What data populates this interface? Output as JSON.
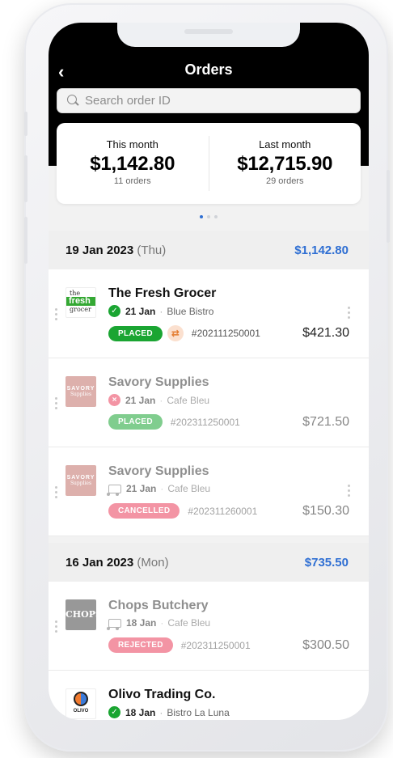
{
  "header": {
    "title": "Orders",
    "back_icon": "chevron-left-icon"
  },
  "search": {
    "placeholder": "Search order ID"
  },
  "summary": {
    "this_month": {
      "label": "This month",
      "amount": "$1,142.80",
      "count": "11 orders"
    },
    "last_month": {
      "label": "Last month",
      "amount": "$12,715.90",
      "count": "29 orders"
    }
  },
  "pager": {
    "pages": 3,
    "active": 0
  },
  "groups": [
    {
      "date": "19 Jan 2023",
      "weekday": "(Thu)",
      "total": "$1,142.80"
    },
    {
      "date": "16 Jan 2023",
      "weekday": "(Mon)",
      "total": "$735.50"
    }
  ],
  "orders": [
    {
      "supplier": "The Fresh Grocer",
      "logo_text": "the fresh grocer",
      "date": "21 Jan",
      "venue": "Blue Bistro",
      "status": "PLACED",
      "status_color": "#1aa532",
      "status_icon": "check-circle-icon",
      "order_id": "#202111250001",
      "price": "$421.30"
    },
    {
      "supplier": "Savory Supplies",
      "logo_text": "SAVORY Supplies",
      "date": "21 Jan",
      "venue": "Cafe Bleu",
      "status": "PLACED",
      "status_color": "#1aa532",
      "status_icon": "x-circle-icon",
      "order_id": "#202311250001",
      "price": "$721.50"
    },
    {
      "supplier": "Savory Supplies",
      "logo_text": "SAVORY Supplies",
      "date": "21 Jan",
      "venue": "Cafe Bleu",
      "status": "CANCELLED",
      "status_color": "#ea3d5a",
      "status_icon": "truck-icon",
      "order_id": "#202311260001",
      "price": "$150.30"
    },
    {
      "supplier": "Chops Butchery",
      "logo_text": "CHOPS",
      "date": "18 Jan",
      "venue": "Cafe Bleu",
      "status": "REJECTED",
      "status_color": "#ea3d5a",
      "status_icon": "truck-icon",
      "order_id": "#202311250001",
      "price": "$300.50"
    },
    {
      "supplier": "Olivo Trading Co.",
      "logo_text": "OLIVO",
      "date": "18 Jan",
      "venue": "Bistro La Luna",
      "status_icon": "check-circle-icon"
    }
  ],
  "colors": {
    "accent": "#2f6fd3",
    "placed": "#1aa532",
    "cancelled": "#ea3d5a",
    "header_bg": "#000000"
  }
}
